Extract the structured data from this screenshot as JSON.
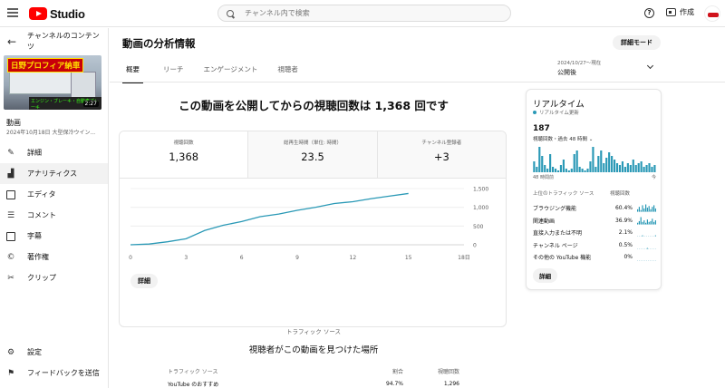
{
  "app": {
    "logo_text": "Studio",
    "brand_color": "#ff0000"
  },
  "search": {
    "placeholder": "チャンネル内で検索"
  },
  "header": {
    "create_label": "作成"
  },
  "sidebar": {
    "title": "チャンネルのコンテンツ",
    "thumbnail": {
      "banner_text": "日野プロフィア納車",
      "sub_text": "エンジン・ブレーキ・自動車ブレーキ",
      "duration": "2:27"
    },
    "video_label": "動画",
    "video_date": "2024年10月18日 大型保冷ウイン...",
    "items": [
      {
        "label": "詳細",
        "icon": "pencil-icon"
      },
      {
        "label": "アナリティクス",
        "icon": "analytics-icon",
        "active": true
      },
      {
        "label": "エディタ",
        "icon": "film-icon"
      },
      {
        "label": "コメント",
        "icon": "comment-icon"
      },
      {
        "label": "字幕",
        "icon": "subtitles-icon"
      },
      {
        "label": "著作権",
        "icon": "copyright-icon"
      },
      {
        "label": "クリップ",
        "icon": "scissors-icon"
      }
    ],
    "bottom_items": [
      {
        "label": "設定",
        "icon": "gear-icon"
      },
      {
        "label": "フィードバックを送信",
        "icon": "feedback-icon"
      }
    ]
  },
  "main": {
    "title": "動画の分析情報",
    "advanced_mode_label": "詳細モード",
    "tabs": [
      "概要",
      "リーチ",
      "エンゲージメント",
      "視聴者"
    ],
    "date_range": {
      "dates": "2024/10/27～現在",
      "label": "公開後"
    },
    "headline": "この動画を公開してからの視聴回数は 1,368 回です",
    "metrics": [
      {
        "label": "視聴回数",
        "value": "1,368"
      },
      {
        "label": "総再生時間（単位: 時間）",
        "value": "23.5"
      },
      {
        "label": "チャンネル登録者",
        "value": "+3"
      }
    ],
    "details_label": "詳細"
  },
  "chart_data": {
    "type": "line",
    "x_ticks": [
      "0",
      "3",
      "6",
      "9",
      "12",
      "15",
      "18日"
    ],
    "y_ticks": [
      "0",
      "500",
      "1,000",
      "1,500"
    ],
    "ylim": [
      0,
      1500
    ],
    "xlim": [
      0,
      18
    ],
    "line_color": "#2a99b6",
    "series": [
      {
        "x": [
          0,
          1,
          2,
          3,
          4,
          5,
          6,
          7,
          8,
          9,
          10,
          11,
          12,
          13,
          14,
          15
        ],
        "values": [
          0,
          20,
          80,
          160,
          380,
          520,
          620,
          750,
          820,
          920,
          1000,
          1100,
          1150,
          1230,
          1300,
          1368
        ]
      }
    ]
  },
  "realtime": {
    "title": "リアルタイム",
    "subtitle": "リアルタイム更新",
    "views": "187",
    "views_label": "視聴回数・過去 48 時間",
    "axis_left": "48 時間前",
    "axis_right": "今",
    "bars": [
      6,
      3,
      14,
      9,
      4,
      2,
      10,
      3,
      2,
      1,
      4,
      7,
      2,
      1,
      2,
      10,
      12,
      3,
      2,
      1,
      2,
      6,
      14,
      3,
      9,
      12,
      5,
      8,
      11,
      9,
      7,
      5,
      4,
      6,
      3,
      5,
      4,
      7,
      4,
      5,
      6,
      3,
      4,
      5,
      3,
      4
    ],
    "bar_color": "#2a99b6",
    "sources_header": "上位のトラフィック ソース",
    "views_header": "視聴回数",
    "sources": [
      {
        "name": "ブラウジング機能",
        "pct": "60.4%",
        "spark": [
          3,
          6,
          2,
          8,
          4,
          9,
          5,
          7,
          3,
          6,
          8,
          4
        ]
      },
      {
        "name": "関連動画",
        "pct": "36.9%",
        "spark": [
          2,
          4,
          9,
          3,
          5,
          2,
          6,
          3,
          4,
          7,
          3,
          5
        ]
      },
      {
        "name": "直接入力または不明",
        "pct": "2.1%",
        "spark": [
          0,
          0,
          0,
          1,
          0,
          0,
          0,
          0,
          0,
          0,
          0,
          1
        ]
      },
      {
        "name": "チャンネル ページ",
        "pct": "0.5%",
        "spark": [
          0,
          0,
          0,
          0,
          0,
          0,
          1,
          0,
          0,
          0,
          0,
          0
        ]
      },
      {
        "name": "その他の YouTube 機能",
        "pct": "0%",
        "spark": [
          0,
          0,
          0,
          0,
          0,
          0,
          0,
          0,
          0,
          0,
          0,
          0
        ]
      }
    ],
    "details_label": "詳細"
  },
  "traffic": {
    "section_label": "トラフィック ソース",
    "title": "視聴者がこの動画を見つけた場所",
    "columns": [
      "トラフィック ソース",
      "割合",
      "視聴回数"
    ],
    "rows": [
      {
        "source": "YouTube のおすすめ",
        "pct": "94.7%",
        "views": "1,296"
      }
    ]
  }
}
